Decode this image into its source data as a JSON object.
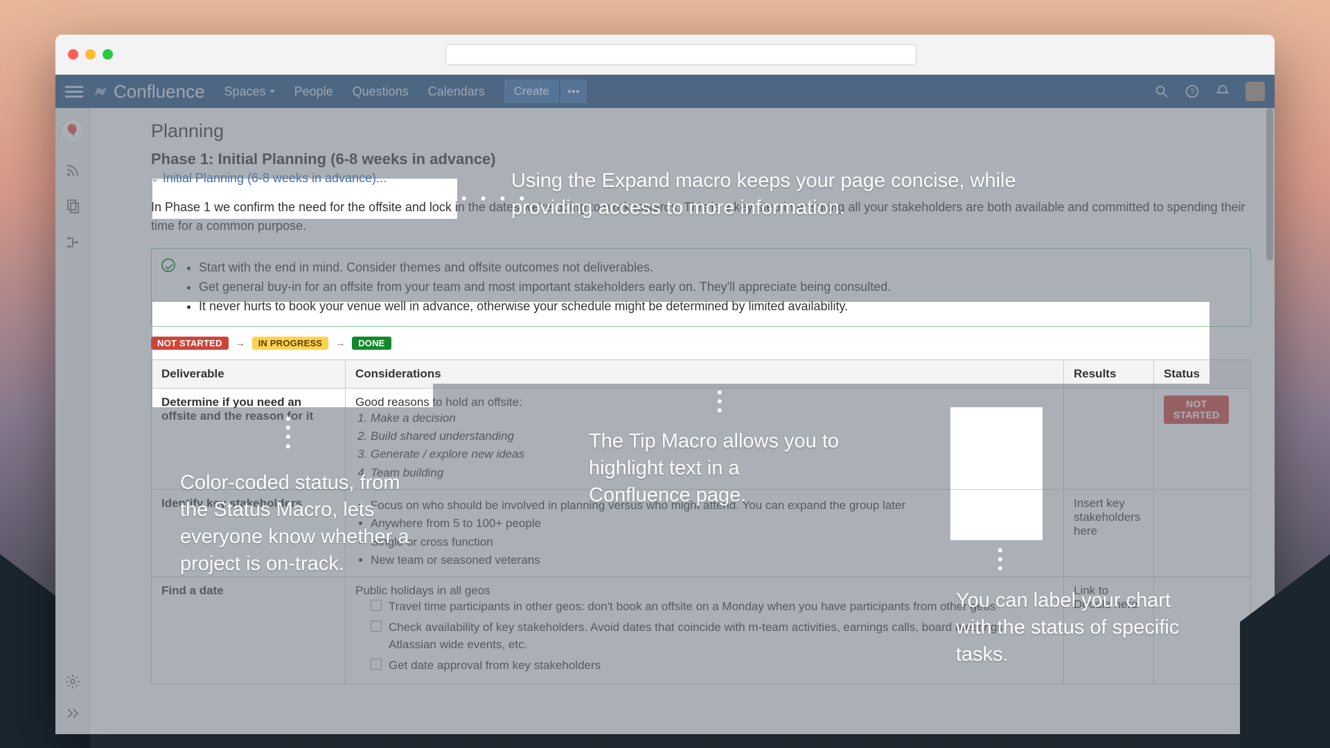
{
  "app": {
    "name": "Confluence"
  },
  "nav": {
    "spaces": "Spaces",
    "people": "People",
    "questions": "Questions",
    "calendars": "Calendars",
    "create": "Create"
  },
  "page": {
    "section": "Planning",
    "phase_heading": "Phase 1: Initial Planning (6-8 weeks in advance)",
    "expand_label": "Initial Planning (6-8 weeks in advance)...",
    "intro": "In Phase 1 we confirm the need for the offsite and lock in the dates we're going to work towards. This is a key step in ensuring all your stakeholders are both available and committed to spending their time for a common purpose."
  },
  "tip": {
    "items": [
      "Start with the end in mind. Consider themes and offsite outcomes not deliverables.",
      "Get general buy-in for an offsite from your team and most important stakeholders early on. They'll appreciate being consulted.",
      "It never hurts to book your venue well in advance, otherwise your schedule might be determined by limited availability."
    ]
  },
  "status": {
    "not_started": "NOT STARTED",
    "in_progress": "IN PROGRESS",
    "done": "DONE",
    "not_started_2line": "NOT\nSTARTED"
  },
  "table": {
    "headers": {
      "deliverable": "Deliverable",
      "considerations": "Considerations",
      "results": "Results",
      "status": "Status"
    },
    "row1": {
      "deliverable": "Determine if you need an offsite and the reason for it",
      "cons_lead": "Good reasons to hold an offsite:",
      "cons_list": [
        "Make a decision",
        "Build shared understanding",
        "Generate / explore new ideas",
        "Team building"
      ],
      "results": "",
      "status": "NOT STARTED"
    },
    "row2": {
      "deliverable": "Identify key stakeholders",
      "cons_list": [
        "Focus on who should be involved in planning versus who might attend. You can expand the group later",
        "Anywhere from 5 to 100+ people",
        "Single or cross function",
        "New team or seasoned veterans"
      ],
      "results": "Insert key stakeholders here"
    },
    "row3": {
      "deliverable": "Find a date",
      "cons_lead": "Public holidays in all geos",
      "check_list": [
        "Travel time participants in other geos: don't book an offsite on a Monday when you have participants from other geos",
        "Check availability of key stakeholders. Avoid dates that coincide with m-team activities, earnings calls, board meetings, Atlassian wide events, etc.",
        "Get date approval from key stakeholders"
      ],
      "results": "Link to Doodle here"
    }
  },
  "annotations": {
    "expand": "Using the Expand macro keeps your page concise, while providing access to more information.",
    "tip": "The Tip Macro allows you to highlight text in a Confluence page.",
    "status_macro": "Color-coded status, from the Status Macro, lets everyone know whether a project is on-track.",
    "label_chart": "You can label your chart with the status of specific tasks."
  }
}
